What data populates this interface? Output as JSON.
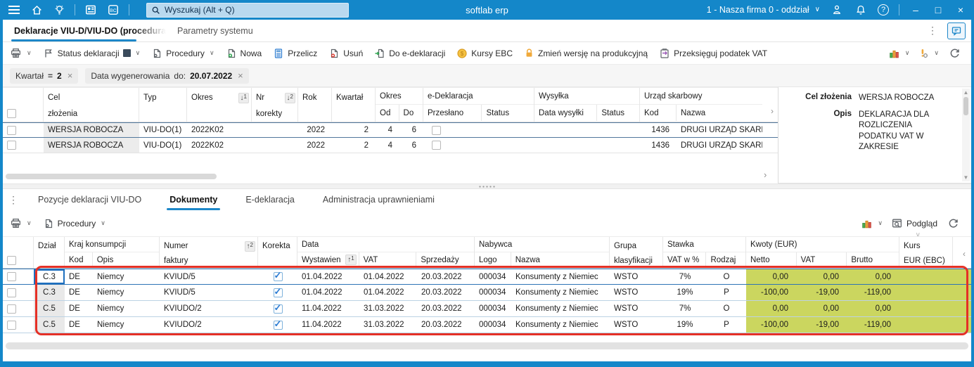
{
  "colors": {
    "accent": "#1487c9",
    "row_highlight": "#cbd65f",
    "annotation": "#e53026"
  },
  "icons": {
    "chevron_down": "∨",
    "chevron_right": "›",
    "chevron_left": "‹",
    "ellipsis_v": "⋮",
    "sort_down": "↓",
    "sort_up": "↑",
    "chip_close": "×"
  },
  "titlebar": {
    "app_title": "softlab erp",
    "search_placeholder": "Wyszukaj (Alt + Q)",
    "company_selector": "1 - Nasza firma 0 - oddział",
    "bc_badge": "BC"
  },
  "window_controls": {
    "help": "?",
    "minimize": "–",
    "maximize": "□",
    "close": "×"
  },
  "tabs": {
    "declarations": "Deklaracje VIU-D/VIU-DO (procedura u",
    "system_params": "Parametry systemu"
  },
  "toolbar": {
    "status": "Status deklaracji",
    "procedures": "Procedury",
    "new": "Nowa",
    "recalc": "Przelicz",
    "delete": "Usuń",
    "to_edeclaration": "Do e-deklaracji",
    "ebc_rates": "Kursy EBC",
    "change_version": "Zmień wersję na produkcyjną",
    "repost_vat": "Przeksięguj podatek VAT"
  },
  "filters": {
    "f1_label": "Kwartał",
    "f1_op": "=",
    "f1_value": "2",
    "f2_label": "Data wygenerowania",
    "f2_op": "do:",
    "f2_value": "20.07.2022"
  },
  "upper_table": {
    "headers": {
      "cel1": "Cel",
      "cel2": "złożenia",
      "typ": "Typ",
      "okres": "Okres",
      "nr1": "Nr",
      "nr2": "korekty",
      "rok": "Rok",
      "kwartal": "Kwartał",
      "okres_grp": "Okres",
      "od": "Od",
      "do": "Do",
      "edek": "e-Deklaracja",
      "przeslano": "Przesłano",
      "status1": "Status",
      "wysylka": "Wysyłka",
      "data_wysylki": "Data wysyłki",
      "status2": "Status",
      "urzad": "Urząd skarbowy",
      "kod": "Kod",
      "nazwa": "Nazwa"
    },
    "sort": {
      "okres": "1",
      "nr": "2"
    },
    "rows": [
      {
        "cel": "WERSJA ROBOCZA",
        "typ": "VIU-DO(1)",
        "okres": "2022K02",
        "rok": "2022",
        "kwartal": "2",
        "od": "4",
        "do": "6",
        "kod": "1436",
        "nazwa": "DRUGI URZĄD SKARBOWY"
      },
      {
        "cel": "WERSJA ROBOCZA",
        "typ": "VIU-DO(1)",
        "okres": "2022K02",
        "rok": "2022",
        "kwartal": "2",
        "od": "4",
        "do": "6",
        "kod": "1436",
        "nazwa": "DRUGI URZĄD SKARBOWY"
      }
    ]
  },
  "detail_panel": {
    "cel_label": "Cel złożenia",
    "cel_value": "WERSJA ROBOCZA",
    "opis_label": "Opis",
    "opis_value": "DEKLARACJA DLA ROZLICZENIA PODATKU VAT W ZAKRESIE"
  },
  "lower_tabs": {
    "positions": "Pozycje deklaracji VIU-DO",
    "documents": "Dokumenty",
    "edeclaration": "E-deklaracja",
    "admin": "Administracja uprawnieniami"
  },
  "lower_toolbar": {
    "procedures": "Procedury",
    "preview": "Podgląd"
  },
  "lower_table": {
    "headers": {
      "dzial": "Dział",
      "kraj": "Kraj konsumpcji",
      "kod": "Kod",
      "opis": "Opis",
      "numer1": "Numer",
      "numer2": "faktury",
      "korekta": "Korekta",
      "data": "Data",
      "wystawien": "Wystawien",
      "vat": "VAT",
      "sprzedazy": "Sprzedaży",
      "nabywca": "Nabywca",
      "logo": "Logo",
      "nazwa": "Nazwa",
      "grupa1": "Grupa",
      "grupa2": "klasyfikacji",
      "stawka": "Stawka",
      "vat_pct": "VAT w %",
      "rodzaj": "Rodzaj",
      "kwoty": "Kwoty (EUR)",
      "netto": "Netto",
      "vat2": "VAT",
      "brutto": "Brutto",
      "kurs1": "Kurs",
      "kurs2": "EUR (EBC)"
    },
    "sort": {
      "numer": "2",
      "wystawien": "1"
    },
    "rows": [
      {
        "dzial": "C.3",
        "kod": "DE",
        "opis": "Niemcy",
        "numer": "KVIUD/5",
        "wystawien": "01.04.2022",
        "vat": "01.04.2022",
        "sprzedazy": "20.03.2022",
        "logo": "000034",
        "nazwa": "Konsumenty z Niemiec",
        "grupa": "WSTO",
        "vat_pct": "7%",
        "rodzaj": "O",
        "netto": "0,00",
        "vat_kw": "0,00",
        "brutto": "0,00"
      },
      {
        "dzial": "C.3",
        "kod": "DE",
        "opis": "Niemcy",
        "numer": "KVIUD/5",
        "wystawien": "01.04.2022",
        "vat": "01.04.2022",
        "sprzedazy": "20.03.2022",
        "logo": "000034",
        "nazwa": "Konsumenty z Niemiec",
        "grupa": "WSTO",
        "vat_pct": "19%",
        "rodzaj": "P",
        "netto": "-100,00",
        "vat_kw": "-19,00",
        "brutto": "-119,00"
      },
      {
        "dzial": "C.5",
        "kod": "DE",
        "opis": "Niemcy",
        "numer": "KVIUDO/2",
        "wystawien": "11.04.2022",
        "vat": "31.03.2022",
        "sprzedazy": "20.03.2022",
        "logo": "000034",
        "nazwa": "Konsumenty z Niemiec",
        "grupa": "WSTO",
        "vat_pct": "7%",
        "rodzaj": "O",
        "netto": "0,00",
        "vat_kw": "0,00",
        "brutto": "0,00"
      },
      {
        "dzial": "C.5",
        "kod": "DE",
        "opis": "Niemcy",
        "numer": "KVIUDO/2",
        "wystawien": "11.04.2022",
        "vat": "31.03.2022",
        "sprzedazy": "20.03.2022",
        "logo": "000034",
        "nazwa": "Konsumenty z Niemiec",
        "grupa": "WSTO",
        "vat_pct": "19%",
        "rodzaj": "P",
        "netto": "-100,00",
        "vat_kw": "-19,00",
        "brutto": "-119,00"
      }
    ]
  }
}
